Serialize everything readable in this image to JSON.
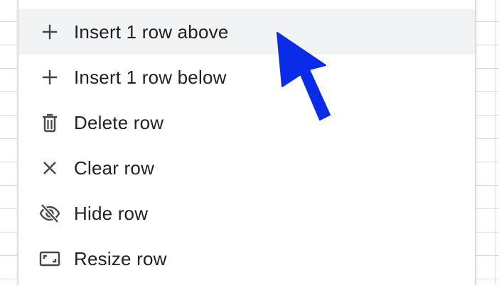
{
  "context_menu": {
    "items": [
      {
        "label": "Insert 1 row above",
        "icon": "plus-icon",
        "highlighted": true
      },
      {
        "label": "Insert 1 row below",
        "icon": "plus-icon",
        "highlighted": false
      },
      {
        "label": "Delete row",
        "icon": "trash-icon",
        "highlighted": false
      },
      {
        "label": "Clear row",
        "icon": "close-icon",
        "highlighted": false
      },
      {
        "label": "Hide row",
        "icon": "eye-off-icon",
        "highlighted": false
      },
      {
        "label": "Resize row",
        "icon": "resize-icon",
        "highlighted": false
      }
    ]
  },
  "colors": {
    "hover_background": "#f1f3f4",
    "text": "#202124",
    "icon": "#444746",
    "pointer": "#0a2be8"
  }
}
